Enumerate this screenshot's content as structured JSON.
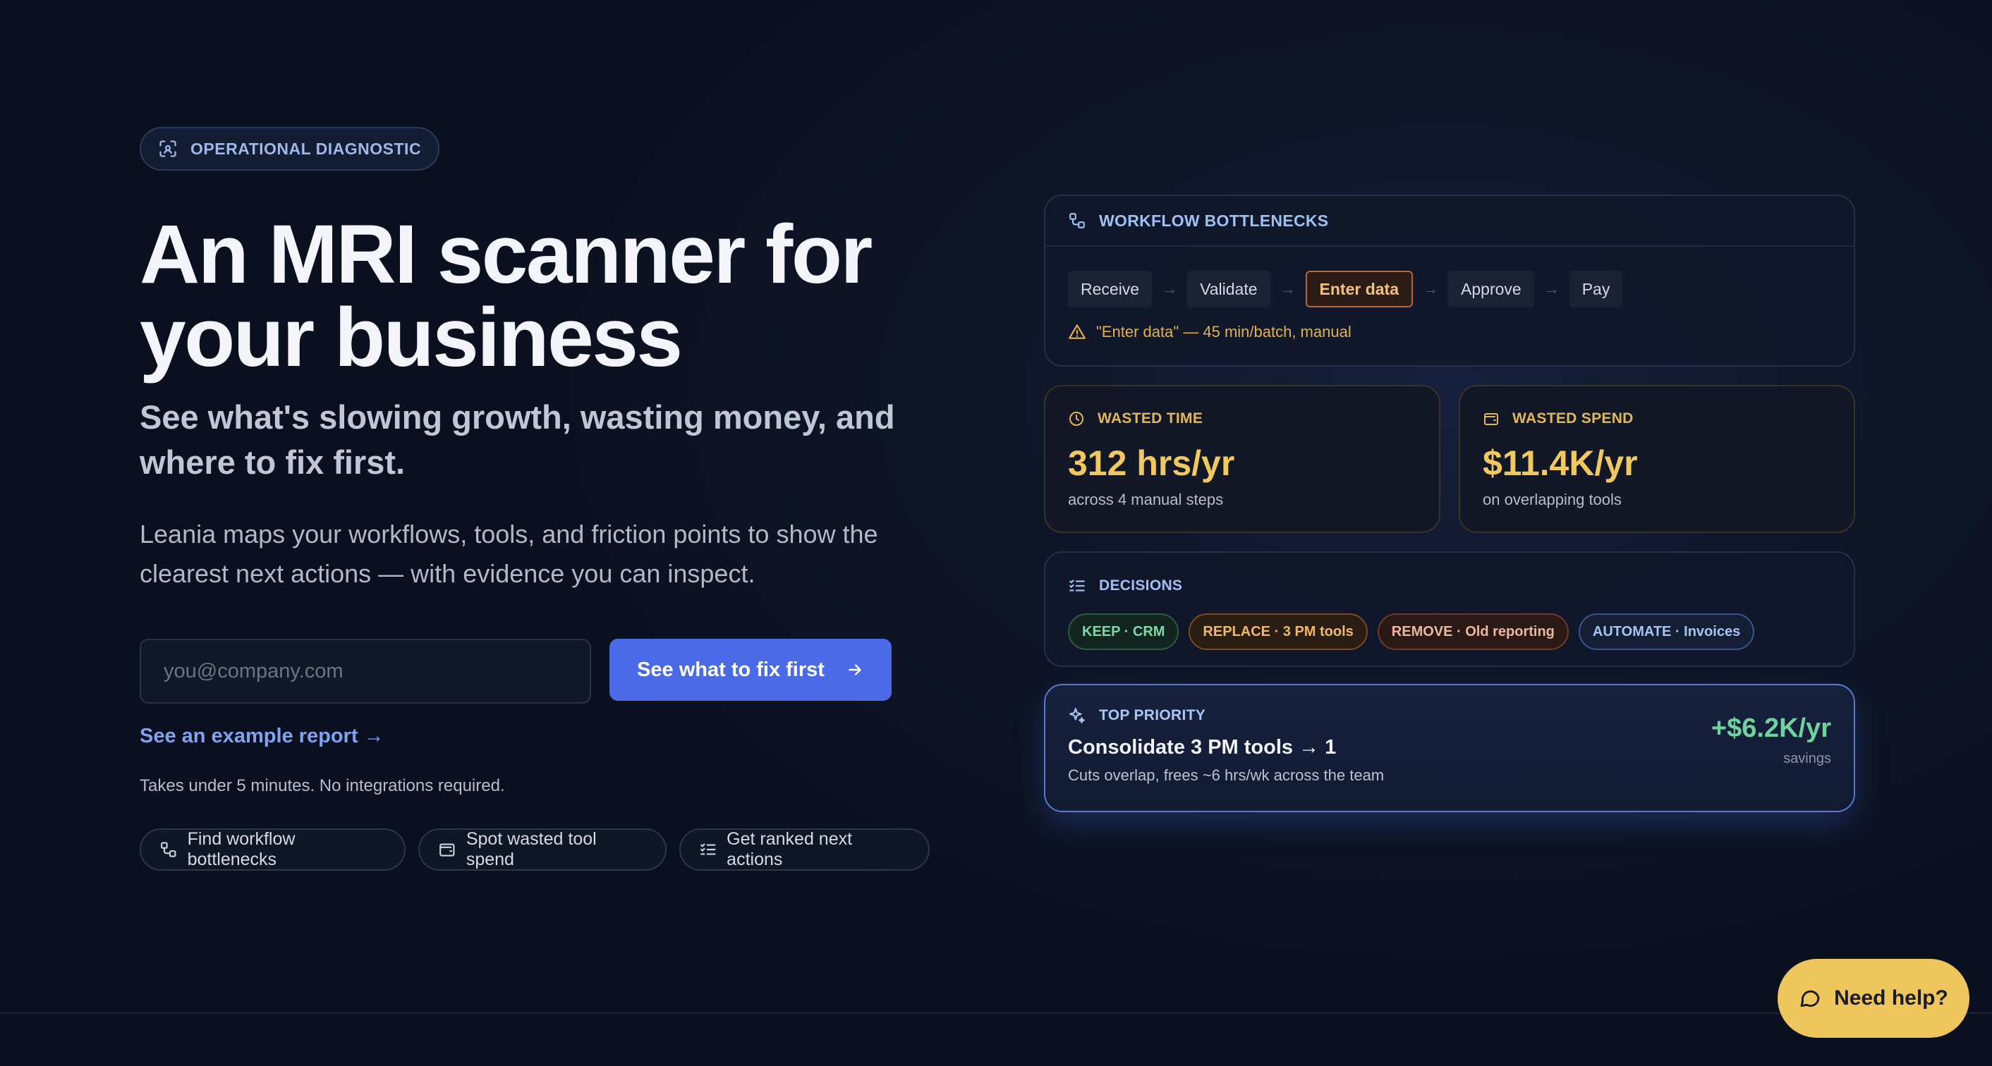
{
  "hero": {
    "eyebrow": "OPERATIONAL DIAGNOSTIC",
    "title": "An MRI scanner for\nyour business",
    "subhead": "See what's slowing growth, wasting money, and\nwhere to fix first.",
    "description": "Leania maps your workflows, tools, and friction points to show the\nclearest next actions — with evidence you can inspect.",
    "email_placeholder": "you@company.com",
    "cta_label": "See what to fix first",
    "example_link": "See an example report →",
    "note": "Takes under 5 minutes. No integrations required.",
    "chips": [
      {
        "label": "Find workflow bottlenecks",
        "icon": "workflow-icon"
      },
      {
        "label": "Spot wasted tool spend",
        "icon": "wallet-icon"
      },
      {
        "label": "Get ranked next actions",
        "icon": "list-check-icon"
      }
    ]
  },
  "workflow": {
    "title": "WORKFLOW BOTTLENECKS",
    "steps": [
      "Receive",
      "Validate",
      "Enter data",
      "Approve",
      "Pay"
    ],
    "highlighted_step": "Enter data",
    "arrow": "→",
    "warning": "\"Enter data\" — 45 min/batch, manual"
  },
  "metrics": {
    "time": {
      "label": "WASTED TIME",
      "value": "312 hrs/yr",
      "sub": "across 4 manual steps"
    },
    "spend": {
      "label": "WASTED SPEND",
      "value": "$11.4K/yr",
      "sub": "on overlapping tools"
    }
  },
  "decisions": {
    "title": "DECISIONS",
    "tags": [
      {
        "label": "KEEP · CRM",
        "kind": "keep"
      },
      {
        "label": "REPLACE · 3 PM tools",
        "kind": "replace"
      },
      {
        "label": "REMOVE · Old reporting",
        "kind": "remove"
      },
      {
        "label": "AUTOMATE · Invoices",
        "kind": "automate"
      }
    ]
  },
  "priority": {
    "label": "TOP PRIORITY",
    "title": "Consolidate 3 PM tools → 1",
    "description": "Cuts overlap, frees ~6 hrs/wk across the team",
    "savings": "+$6.2K/yr",
    "savings_label": "savings"
  },
  "help": {
    "label": "Need help?"
  },
  "colors": {
    "accent": "#4a6ae8",
    "warning": "#e2b04f",
    "success": "#6fd3a0",
    "help_button": "#efc65c"
  }
}
